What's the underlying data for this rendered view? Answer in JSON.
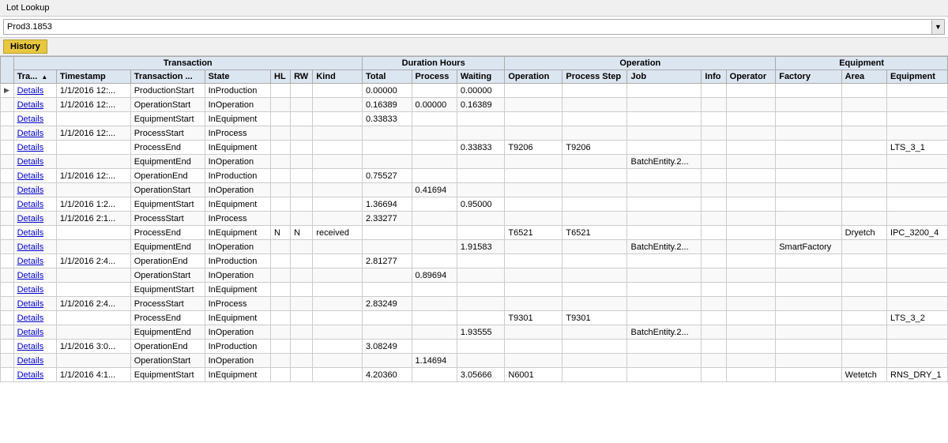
{
  "app": {
    "title": "Lot Lookup",
    "lookup_value": "Prod3.1853"
  },
  "tabs": [
    {
      "label": "History",
      "active": true
    }
  ],
  "table": {
    "col_groups": [
      {
        "label": "Transaction",
        "colspan": 7
      },
      {
        "label": "Duration Hours",
        "colspan": 3
      },
      {
        "label": "Operation",
        "colspan": 5
      },
      {
        "label": "Equipment",
        "colspan": 3
      }
    ],
    "headers": [
      "Tra...",
      "Timestamp",
      "Transaction ...",
      "State",
      "HL",
      "RW",
      "Kind",
      "Total",
      "Process",
      "Waiting",
      "Operation",
      "Process Step",
      "Job",
      "Info",
      "Operator",
      "Factory",
      "Area",
      "Equipment"
    ],
    "rows": [
      {
        "arrow": "▶",
        "details": "Details",
        "timestamp": "1/1/2016 12:...",
        "transtype": "ProductionStart",
        "state": "InProduction",
        "hl": "",
        "rw": "",
        "kind": "",
        "total": "0.00000",
        "process": "",
        "waiting": "0.00000",
        "operation": "",
        "procstep": "",
        "job": "",
        "info": "",
        "operator": "",
        "factory": "",
        "area": "",
        "equipment": ""
      },
      {
        "arrow": "",
        "details": "Details",
        "timestamp": "1/1/2016 12:...",
        "transtype": "OperationStart",
        "state": "InOperation",
        "hl": "",
        "rw": "",
        "kind": "",
        "total": "0.16389",
        "process": "0.00000",
        "waiting": "0.16389",
        "operation": "",
        "procstep": "",
        "job": "",
        "info": "",
        "operator": "",
        "factory": "",
        "area": "",
        "equipment": ""
      },
      {
        "arrow": "",
        "details": "Details",
        "timestamp": "",
        "transtype": "EquipmentStart",
        "state": "InEquipment",
        "hl": "",
        "rw": "",
        "kind": "",
        "total": "0.33833",
        "process": "",
        "waiting": "",
        "operation": "",
        "procstep": "",
        "job": "",
        "info": "",
        "operator": "",
        "factory": "",
        "area": "",
        "equipment": ""
      },
      {
        "arrow": "",
        "details": "Details",
        "timestamp": "1/1/2016 12:...",
        "transtype": "ProcessStart",
        "state": "InProcess",
        "hl": "",
        "rw": "",
        "kind": "",
        "total": "",
        "process": "",
        "waiting": "",
        "operation": "",
        "procstep": "",
        "job": "",
        "info": "",
        "operator": "",
        "factory": "",
        "area": "",
        "equipment": ""
      },
      {
        "arrow": "",
        "details": "Details",
        "timestamp": "",
        "transtype": "ProcessEnd",
        "state": "InEquipment",
        "hl": "",
        "rw": "",
        "kind": "",
        "total": "",
        "process": "",
        "waiting": "0.33833",
        "operation": "T9206",
        "procstep": "T9206",
        "job": "",
        "info": "",
        "operator": "",
        "factory": "",
        "area": "",
        "equipment": "LTS_3_1"
      },
      {
        "arrow": "",
        "details": "Details",
        "timestamp": "",
        "transtype": "EquipmentEnd",
        "state": "InOperation",
        "hl": "",
        "rw": "",
        "kind": "",
        "total": "",
        "process": "",
        "waiting": "",
        "operation": "",
        "procstep": "",
        "job": "BatchEntity.2...",
        "info": "",
        "operator": "",
        "factory": "",
        "area": "",
        "equipment": ""
      },
      {
        "arrow": "",
        "details": "Details",
        "timestamp": "1/1/2016 12:...",
        "transtype": "OperationEnd",
        "state": "InProduction",
        "hl": "",
        "rw": "",
        "kind": "",
        "total": "0.75527",
        "process": "",
        "waiting": "",
        "operation": "",
        "procstep": "",
        "job": "",
        "info": "",
        "operator": "",
        "factory": "",
        "area": "",
        "equipment": ""
      },
      {
        "arrow": "",
        "details": "Details",
        "timestamp": "",
        "transtype": "OperationStart",
        "state": "InOperation",
        "hl": "",
        "rw": "",
        "kind": "",
        "total": "",
        "process": "0.41694",
        "waiting": "",
        "operation": "",
        "procstep": "",
        "job": "",
        "info": "",
        "operator": "",
        "factory": "",
        "area": "",
        "equipment": ""
      },
      {
        "arrow": "",
        "details": "Details",
        "timestamp": "1/1/2016 1:2...",
        "transtype": "EquipmentStart",
        "state": "InEquipment",
        "hl": "",
        "rw": "",
        "kind": "",
        "total": "1.36694",
        "process": "",
        "waiting": "0.95000",
        "operation": "",
        "procstep": "",
        "job": "",
        "info": "",
        "operator": "",
        "factory": "",
        "area": "",
        "equipment": ""
      },
      {
        "arrow": "",
        "details": "Details",
        "timestamp": "1/1/2016 2:1...",
        "transtype": "ProcessStart",
        "state": "InProcess",
        "hl": "",
        "rw": "",
        "kind": "",
        "total": "2.33277",
        "process": "",
        "waiting": "",
        "operation": "",
        "procstep": "",
        "job": "",
        "info": "",
        "operator": "",
        "factory": "",
        "area": "",
        "equipment": ""
      },
      {
        "arrow": "",
        "details": "Details",
        "timestamp": "",
        "transtype": "ProcessEnd",
        "state": "InEquipment",
        "hl": "N",
        "rw": "N",
        "kind": "received",
        "total": "",
        "process": "",
        "waiting": "",
        "operation": "T6521",
        "procstep": "T6521",
        "job": "",
        "info": "",
        "operator": "",
        "factory": "",
        "area": "Dryetch",
        "equipment": "IPC_3200_4"
      },
      {
        "arrow": "",
        "details": "Details",
        "timestamp": "",
        "transtype": "EquipmentEnd",
        "state": "InOperation",
        "hl": "",
        "rw": "",
        "kind": "",
        "total": "",
        "process": "",
        "waiting": "1.91583",
        "operation": "",
        "procstep": "",
        "job": "BatchEntity.2...",
        "info": "",
        "operator": "",
        "factory": "SmartFactory",
        "area": "",
        "equipment": ""
      },
      {
        "arrow": "",
        "details": "Details",
        "timestamp": "1/1/2016 2:4...",
        "transtype": "OperationEnd",
        "state": "InProduction",
        "hl": "",
        "rw": "",
        "kind": "",
        "total": "2.81277",
        "process": "",
        "waiting": "",
        "operation": "",
        "procstep": "",
        "job": "",
        "info": "",
        "operator": "",
        "factory": "",
        "area": "",
        "equipment": ""
      },
      {
        "arrow": "",
        "details": "Details",
        "timestamp": "",
        "transtype": "OperationStart",
        "state": "InOperation",
        "hl": "",
        "rw": "",
        "kind": "",
        "total": "",
        "process": "0.89694",
        "waiting": "",
        "operation": "",
        "procstep": "",
        "job": "",
        "info": "",
        "operator": "",
        "factory": "",
        "area": "",
        "equipment": ""
      },
      {
        "arrow": "",
        "details": "Details",
        "timestamp": "",
        "transtype": "EquipmentStart",
        "state": "InEquipment",
        "hl": "",
        "rw": "",
        "kind": "",
        "total": "",
        "process": "",
        "waiting": "",
        "operation": "",
        "procstep": "",
        "job": "",
        "info": "",
        "operator": "",
        "factory": "",
        "area": "",
        "equipment": ""
      },
      {
        "arrow": "",
        "details": "Details",
        "timestamp": "1/1/2016 2:4...",
        "transtype": "ProcessStart",
        "state": "InProcess",
        "hl": "",
        "rw": "",
        "kind": "",
        "total": "2.83249",
        "process": "",
        "waiting": "",
        "operation": "",
        "procstep": "",
        "job": "",
        "info": "",
        "operator": "",
        "factory": "",
        "area": "",
        "equipment": ""
      },
      {
        "arrow": "",
        "details": "Details",
        "timestamp": "",
        "transtype": "ProcessEnd",
        "state": "InEquipment",
        "hl": "",
        "rw": "",
        "kind": "",
        "total": "",
        "process": "",
        "waiting": "",
        "operation": "T9301",
        "procstep": "T9301",
        "job": "",
        "info": "",
        "operator": "",
        "factory": "",
        "area": "",
        "equipment": "LTS_3_2"
      },
      {
        "arrow": "",
        "details": "Details",
        "timestamp": "",
        "transtype": "EquipmentEnd",
        "state": "InOperation",
        "hl": "",
        "rw": "",
        "kind": "",
        "total": "",
        "process": "",
        "waiting": "1.93555",
        "operation": "",
        "procstep": "",
        "job": "BatchEntity.2...",
        "info": "",
        "operator": "",
        "factory": "",
        "area": "",
        "equipment": ""
      },
      {
        "arrow": "",
        "details": "Details",
        "timestamp": "1/1/2016 3:0...",
        "transtype": "OperationEnd",
        "state": "InProduction",
        "hl": "",
        "rw": "",
        "kind": "",
        "total": "3.08249",
        "process": "",
        "waiting": "",
        "operation": "",
        "procstep": "",
        "job": "",
        "info": "",
        "operator": "",
        "factory": "",
        "area": "",
        "equipment": ""
      },
      {
        "arrow": "",
        "details": "Details",
        "timestamp": "",
        "transtype": "OperationStart",
        "state": "InOperation",
        "hl": "",
        "rw": "",
        "kind": "",
        "total": "",
        "process": "1.14694",
        "waiting": "",
        "operation": "",
        "procstep": "",
        "job": "",
        "info": "",
        "operator": "",
        "factory": "",
        "area": "",
        "equipment": ""
      },
      {
        "arrow": "",
        "details": "Details",
        "timestamp": "1/1/2016 4:1...",
        "transtype": "EquipmentStart",
        "state": "InEquipment",
        "hl": "",
        "rw": "",
        "kind": "",
        "total": "4.20360",
        "process": "",
        "waiting": "3.05666",
        "operation": "N6001",
        "procstep": "",
        "job": "",
        "info": "",
        "operator": "",
        "factory": "",
        "area": "Wetetch",
        "equipment": "RNS_DRY_1"
      }
    ]
  }
}
